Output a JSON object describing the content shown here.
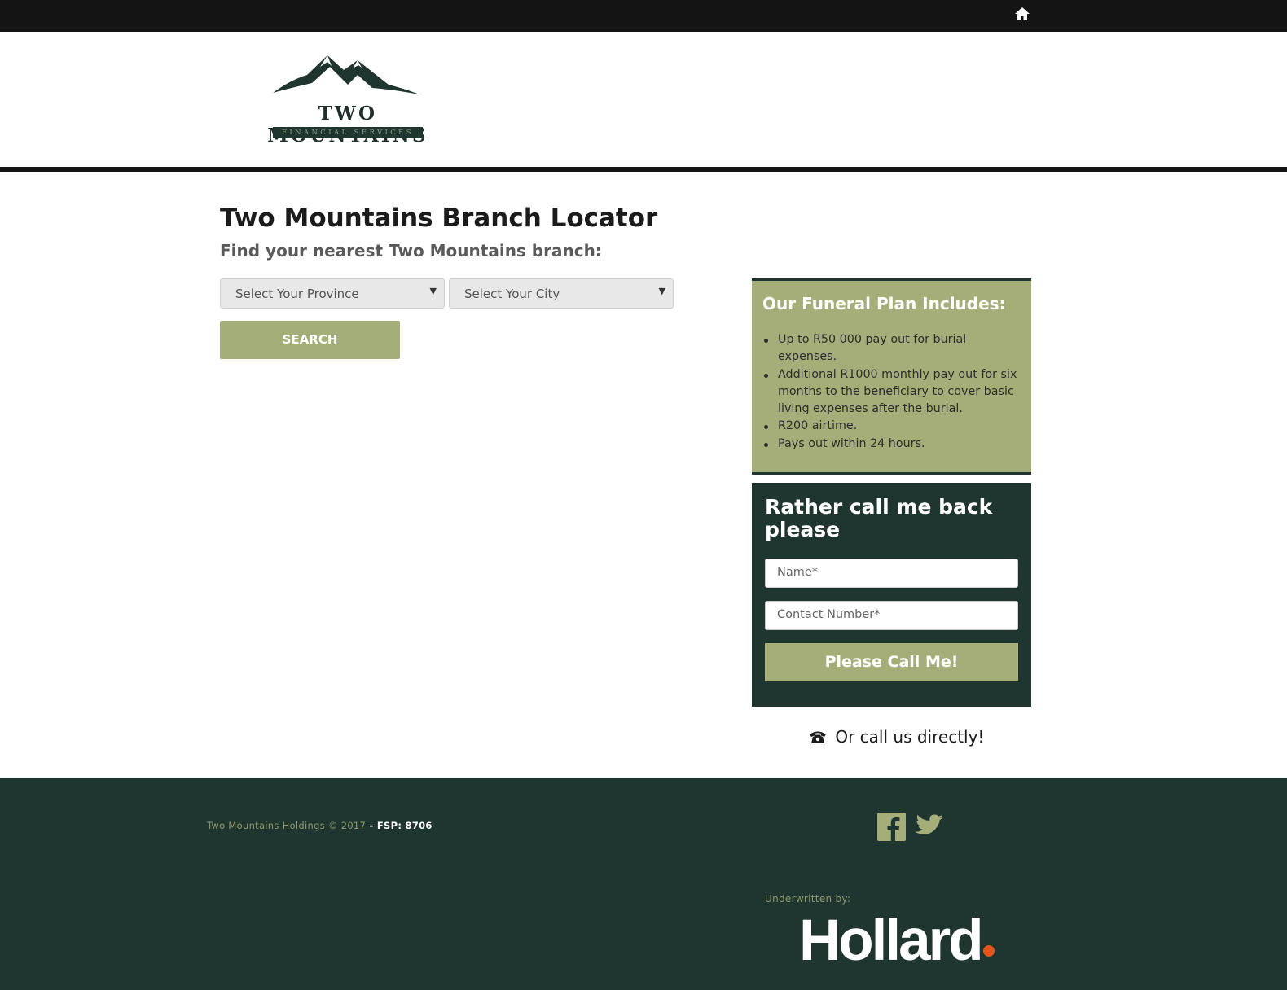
{
  "topbar": {
    "home_icon": "home-icon"
  },
  "logo": {
    "brand": "TWO MOUNTAINS",
    "tagline": "FINANCIAL SERVICES"
  },
  "main": {
    "title": "Two Mountains Branch Locator",
    "subtitle": "Find your nearest Two Mountains branch:",
    "province_select": "Select Your Province",
    "city_select": "Select Your City",
    "search_label": "SEARCH"
  },
  "plan": {
    "title": "Our Funeral Plan Includes:",
    "items": [
      "Up to R50 000 pay out for burial expenses.",
      "Additional R1000 monthly pay out for six months to the beneficiary to cover basic living expenses after the burial.",
      "R200 airtime.",
      "Pays out within 24 hours."
    ]
  },
  "callback": {
    "title": "Rather call me back please",
    "name_placeholder": "Name*",
    "contact_placeholder": "Contact Number*",
    "button_label": "Please Call Me!"
  },
  "call_direct": {
    "label": "Or call us directly!",
    "icon": "phone-icon"
  },
  "footer": {
    "copyright": "Two Mountains Holdings © 2017",
    "fsp": " - FSP: 8706",
    "social": [
      "facebook-icon",
      "twitter-icon"
    ],
    "underwritten": "Underwritten by:",
    "underwriter": "Hollard"
  },
  "colors": {
    "topbar": "#141414",
    "olive": "#a5ae79",
    "dark_green": "#1f3530",
    "hollard_dot": "#e5561c"
  }
}
